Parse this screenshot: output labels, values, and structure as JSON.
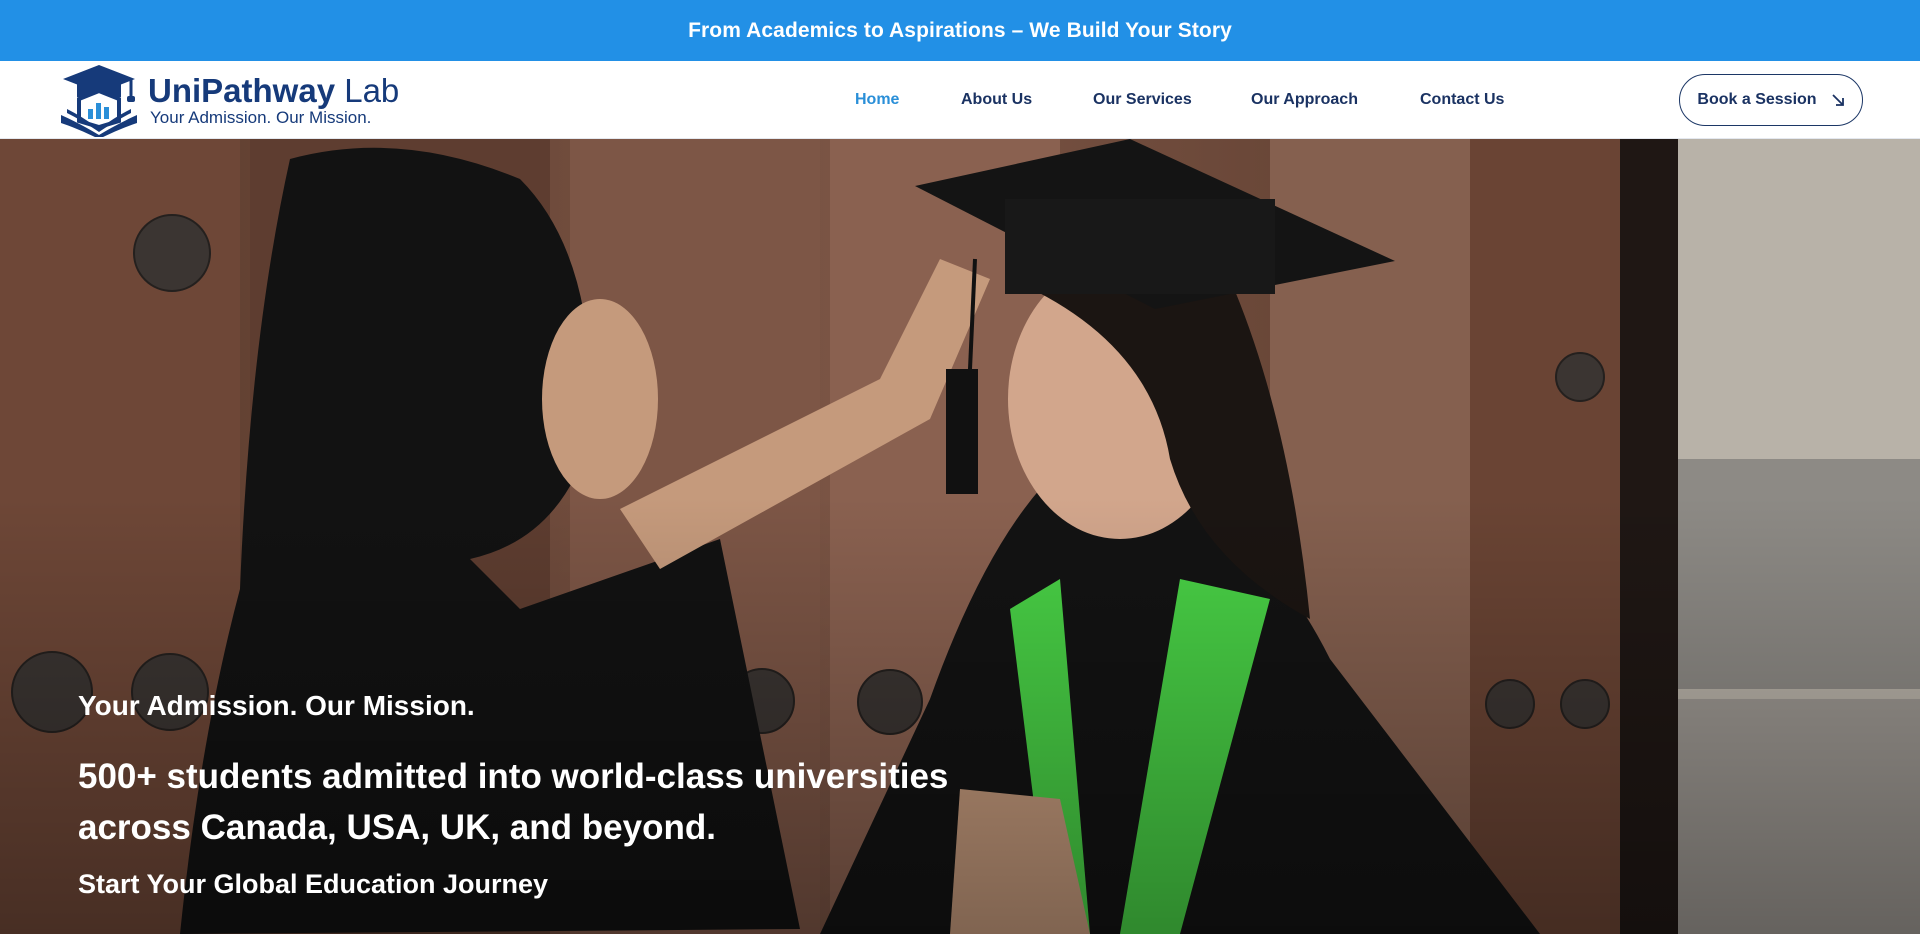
{
  "announcement": {
    "text": "From Academics to Aspirations – We Build Your Story"
  },
  "brand": {
    "name_strong": "UniPathway",
    "name_light": " Lab",
    "tagline": "Your Admission. Our Mission.",
    "icon": "graduation-cap-book-icon"
  },
  "nav": {
    "items": [
      {
        "label": "Home",
        "active": true
      },
      {
        "label": "About Us",
        "active": false
      },
      {
        "label": "Our Services",
        "active": false
      },
      {
        "label": "Our Approach",
        "active": false
      },
      {
        "label": "Contact Us",
        "active": false
      }
    ],
    "cta_label": "Book a Session",
    "cta_icon": "arrow-down-right-icon"
  },
  "hero": {
    "subtitle": "Your Admission. Our Mission.",
    "headline": "500+ students admitted into world-class universities across Canada, USA, UK, and beyond.",
    "cta_text": "Start Your Global Education Journey"
  },
  "colors": {
    "announce_bg": "#2290e6",
    "brand_navy": "#163a7a",
    "nav_active": "#2a8fd8",
    "nav_text": "#1a3262"
  }
}
